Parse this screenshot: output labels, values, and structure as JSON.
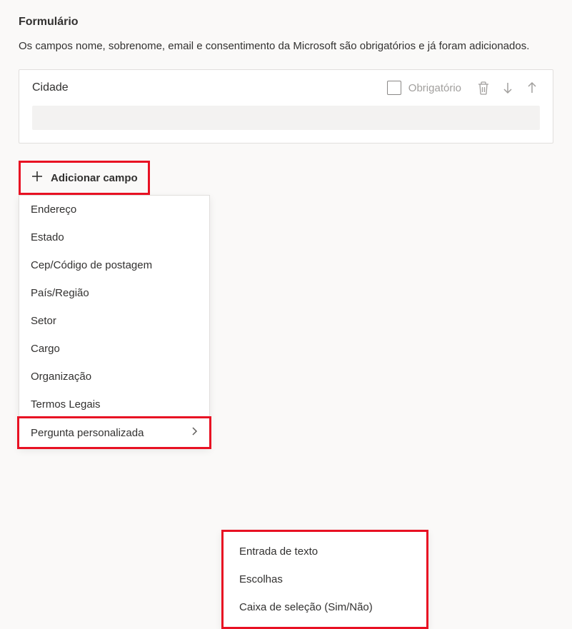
{
  "section_title": "Formulário",
  "description": "Os campos nome, sobrenome, email e consentimento da Microsoft são obrigatórios e já foram adicionados.",
  "field": {
    "name": "Cidade",
    "required_label": "Obrigatório"
  },
  "add_field_label": "Adicionar campo",
  "dropdown": {
    "items": [
      {
        "label": "Endereço"
      },
      {
        "label": "Estado"
      },
      {
        "label": "Cep/Código de postagem"
      },
      {
        "label": "País/Região"
      },
      {
        "label": "Setor"
      },
      {
        "label": "Cargo"
      },
      {
        "label": "Organização"
      },
      {
        "label": "Termos Legais"
      },
      {
        "label": "Pergunta personalizada",
        "has_submenu": true
      }
    ]
  },
  "submenu": {
    "items": [
      {
        "label": "Entrada de texto"
      },
      {
        "label": "Escolhas"
      },
      {
        "label": "Caixa de seleção (Sim/Não)"
      }
    ]
  }
}
